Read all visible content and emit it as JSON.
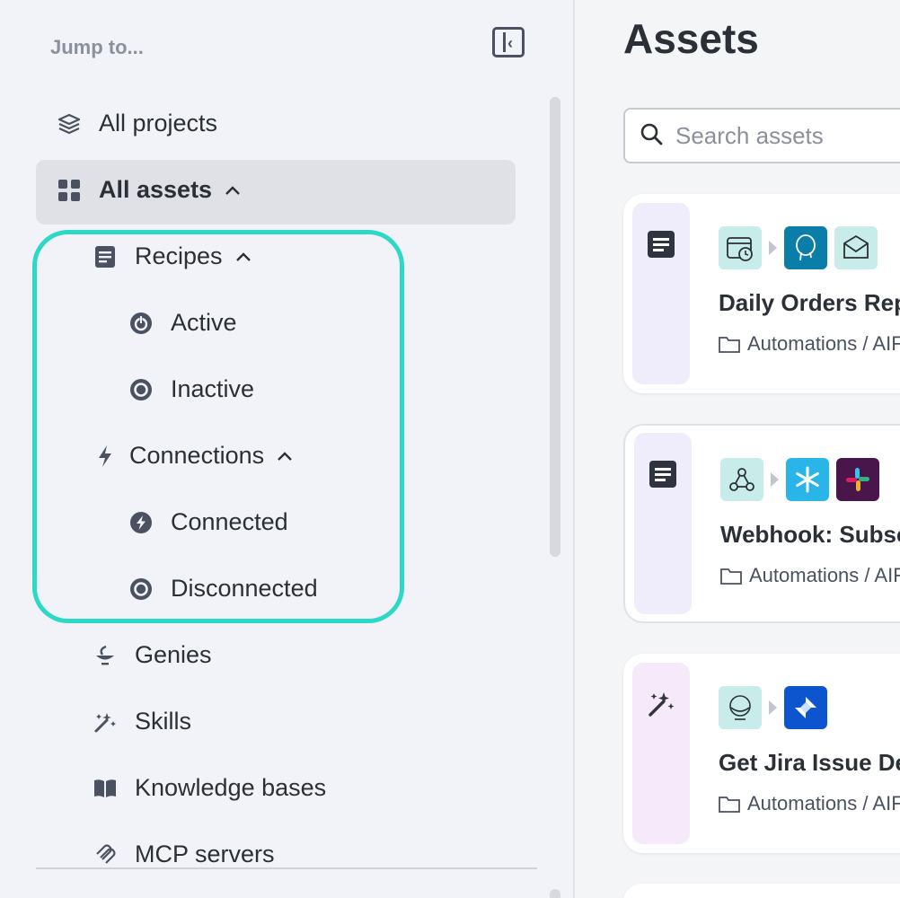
{
  "sidebar": {
    "jump_to": "Jump to...",
    "items": [
      {
        "label": "All projects",
        "icon": "layers-icon"
      },
      {
        "label": "All assets",
        "icon": "grid-icon"
      },
      {
        "label": "Recipes",
        "icon": "document-icon"
      },
      {
        "label": "Active",
        "icon": "power-icon"
      },
      {
        "label": "Inactive",
        "icon": "target-icon"
      },
      {
        "label": "Connections",
        "icon": "bolt-icon"
      },
      {
        "label": "Connected",
        "icon": "bolt-circle-icon"
      },
      {
        "label": "Disconnected",
        "icon": "target-icon"
      },
      {
        "label": "Genies",
        "icon": "genie-lamp-icon"
      },
      {
        "label": "Skills",
        "icon": "magic-wand-icon"
      },
      {
        "label": "Knowledge bases",
        "icon": "book-icon"
      },
      {
        "label": "MCP servers",
        "icon": "mcp-icon"
      }
    ]
  },
  "main": {
    "title": "Assets",
    "search_placeholder": "Search assets",
    "cards": [
      {
        "title": "Daily Orders Repo",
        "path": "Automations / AIF",
        "type_icon": "document-icon",
        "apps": [
          "scheduler-icon",
          "postgresql-icon",
          "email-icon"
        ]
      },
      {
        "title": "Webhook: Subscr",
        "path": "Automations / AIF",
        "type_icon": "document-icon",
        "apps": [
          "webhook-icon",
          "snowflake-icon",
          "slack-icon"
        ]
      },
      {
        "title": "Get Jira Issue Det",
        "path": "Automations / AIF",
        "type_icon": "magic-wand-icon",
        "apps": [
          "genie-icon",
          "jira-icon"
        ]
      }
    ]
  },
  "colors": {
    "highlight": "#2cd8c6",
    "active_bg": "#dfe1e6",
    "recipe_strip": "#efedfc",
    "skill_strip": "#f6eafa"
  }
}
